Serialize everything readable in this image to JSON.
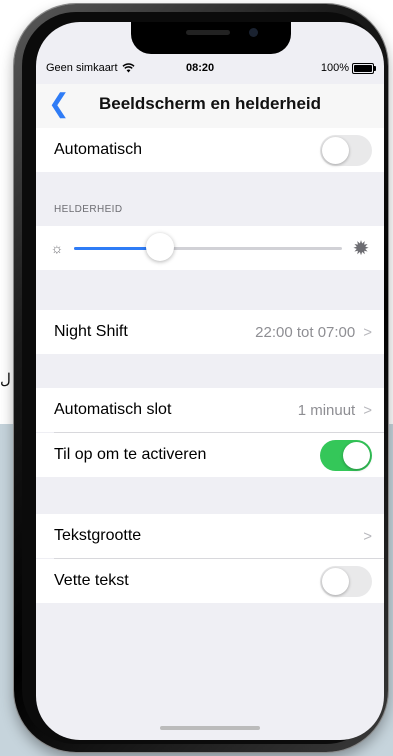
{
  "status": {
    "carrier": "Geen simkaart",
    "wifi_icon": "wifi-icon",
    "time": "08:20",
    "battery": "100%"
  },
  "nav": {
    "back_icon": "chevron-left-icon",
    "back_glyph": "❮",
    "title": "Beeldscherm en helderheid"
  },
  "rows": {
    "auto": {
      "label": "Automatisch",
      "toggle_on": false
    },
    "brightness_header": "HELDERHEID",
    "brightness": {
      "level": 0.32,
      "low_icon": "sun-small-icon",
      "high_icon": "sun-large-icon"
    },
    "night_shift": {
      "label": "Night Shift",
      "value": "22:00 tot 07:00"
    },
    "auto_lock": {
      "label": "Automatisch slot",
      "value": "1 minuut"
    },
    "raise_to_wake": {
      "label": "Til op om te activeren",
      "toggle_on": true
    },
    "text_size": {
      "label": "Tekstgrootte"
    },
    "bold_text": {
      "label": "Vette tekst",
      "toggle_on": false
    }
  },
  "chevron_glyph": ">",
  "stray_char": "ل",
  "colors": {
    "accent": "#2f7cf6",
    "toggle_on": "#34c759",
    "toggle_off": "#e9e9ea",
    "background": "#efeff4"
  }
}
